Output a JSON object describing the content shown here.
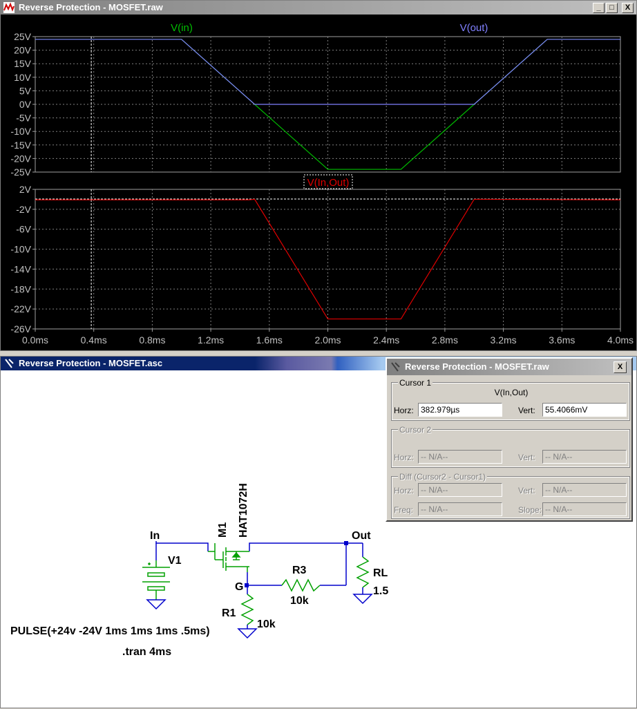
{
  "waveform_window": {
    "title": "Reverse Protection - MOSFET.raw",
    "buttons": {
      "minimize": "_",
      "maximize": "□",
      "close": "X"
    }
  },
  "schematic_window": {
    "title": "Reverse Protection - MOSFET.asc"
  },
  "cursor_dialog": {
    "title": "Reverse Protection - MOSFET.raw",
    "close": "X",
    "cursor1": {
      "title": "Cursor 1",
      "trace": "V(In,Out)",
      "horz_label": "Horz:",
      "horz_value": "382.979µs",
      "vert_label": "Vert:",
      "vert_value": "55.4066mV"
    },
    "cursor2": {
      "title": "Cursor 2",
      "horz_label": "Horz:",
      "horz_value": "-- N/A--",
      "vert_label": "Vert:",
      "vert_value": "-- N/A--"
    },
    "diff": {
      "title": "Diff (Cursor2 - Cursor1)",
      "horz_label": "Horz:",
      "horz_value": "-- N/A--",
      "vert_label": "Vert:",
      "vert_value": "-- N/A--",
      "freq_label": "Freq:",
      "freq_value": "-- N/A--",
      "slope_label": "Slope:",
      "slope_value": "-- N/A--"
    }
  },
  "schematic": {
    "labels": {
      "in": "In",
      "out": "Out",
      "v1": "V1",
      "m1": "M1",
      "m1_model": "HAT1072H",
      "g": "G",
      "r1": "R1",
      "r1_val": "10k",
      "r3": "R3",
      "r3_val": "10k",
      "rl": "RL",
      "rl_val": "1.5",
      "pulse": "PULSE(+24v -24V 1ms 1ms 1ms .5ms)",
      "tran": ".tran 4ms"
    }
  },
  "colors": {
    "vin": "#00c000",
    "vout": "#8080ff",
    "vdiff": "#e00000",
    "plot_bg": "#000000",
    "grid": "#808080",
    "wire": "#0000cc",
    "component": "#00a000"
  },
  "chart_data": [
    {
      "type": "line",
      "title": "",
      "xlabel": "",
      "ylabel": "",
      "xlim": [
        0,
        4.0
      ],
      "ylim": [
        -25,
        25
      ],
      "x_ticks": [
        "0.0ms",
        "0.4ms",
        "0.8ms",
        "1.2ms",
        "1.6ms",
        "2.0ms",
        "2.4ms",
        "2.8ms",
        "3.2ms",
        "3.6ms",
        "4.0ms"
      ],
      "y_ticks": [
        "25V",
        "20V",
        "15V",
        "10V",
        "5V",
        "0V",
        "-5V",
        "-10V",
        "-15V",
        "-20V",
        "-25V"
      ],
      "grid": true,
      "cursor_x": 0.383,
      "series": [
        {
          "name": "V(in)",
          "x": [
            0,
            1.0,
            2.0,
            2.5,
            3.5,
            4.0
          ],
          "y": [
            24,
            24,
            -24,
            -24,
            24,
            24
          ]
        },
        {
          "name": "V(out)",
          "x": [
            0,
            1.0,
            1.5,
            3.0,
            3.5,
            4.0
          ],
          "y": [
            24,
            24,
            0,
            0,
            24,
            24
          ]
        }
      ]
    },
    {
      "type": "line",
      "title": "",
      "xlabel": "",
      "ylabel": "",
      "xlim": [
        0,
        4.0
      ],
      "ylim": [
        -26,
        2
      ],
      "y_ticks": [
        "2V",
        "-2V",
        "-6V",
        "-10V",
        "-14V",
        "-18V",
        "-22V",
        "-26V"
      ],
      "grid": true,
      "cursor_x": 0.383,
      "cursor_y": 0.055,
      "series": [
        {
          "name": "V(In,Out)",
          "x": [
            0,
            1.46,
            1.5,
            2.0,
            2.5,
            3.0,
            3.04,
            4.0
          ],
          "y": [
            -0.1,
            -0.1,
            0,
            -24,
            -24,
            0,
            0,
            -0.1
          ]
        }
      ]
    }
  ]
}
